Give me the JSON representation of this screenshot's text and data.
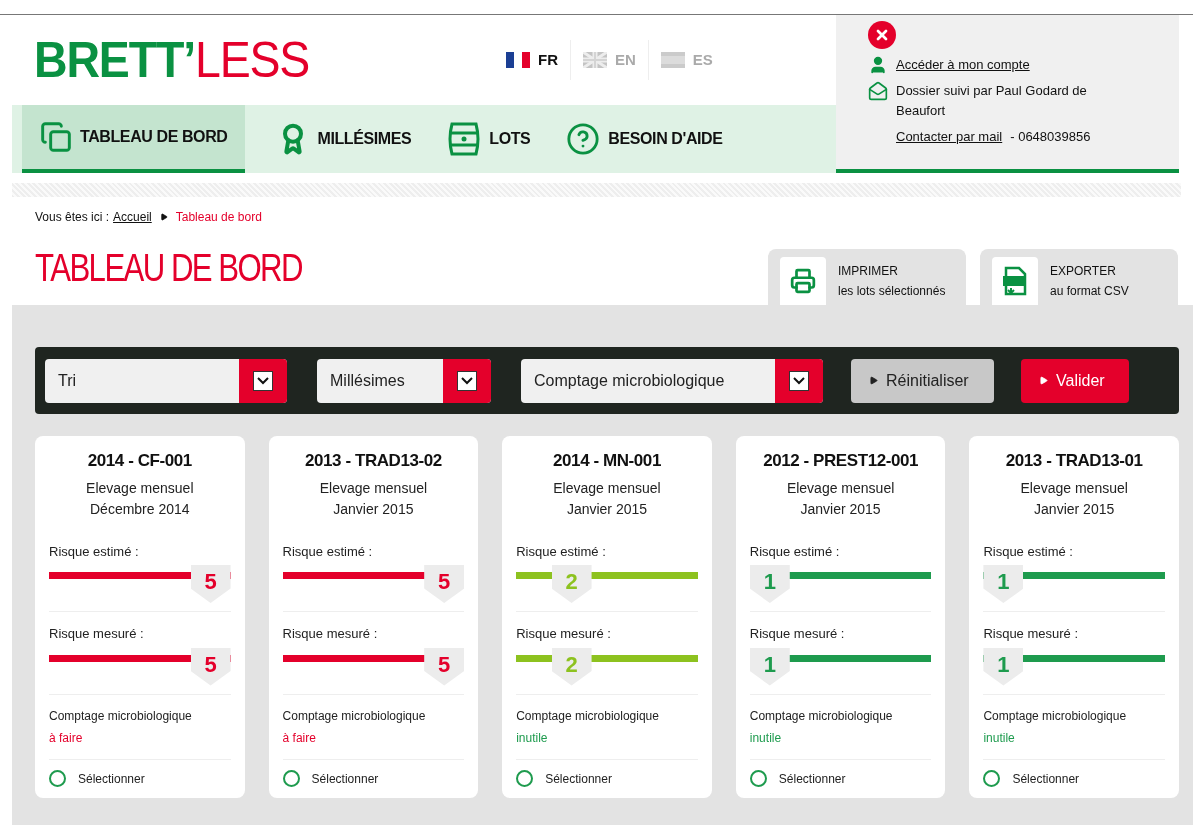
{
  "logo": {
    "first": "BRETT’",
    "second": "LESS"
  },
  "languages": [
    {
      "code": "FR",
      "selected": true
    },
    {
      "code": "EN",
      "selected": false
    },
    {
      "code": "ES",
      "selected": false
    }
  ],
  "nav": [
    {
      "label": "TABLEAU DE BORD",
      "selected": true
    },
    {
      "label": "MILLÉSIMES",
      "selected": false
    },
    {
      "label": "LOTS",
      "selected": false
    },
    {
      "label": "BESOIN D'AIDE",
      "selected": false
    }
  ],
  "account": {
    "account_link": "Accéder à mon compte",
    "followed_by": "Dossier suivi par Paul Godard de Beaufort",
    "contact_link": "Contacter par mail",
    "phone": "- 0648039856"
  },
  "breadcrumb": {
    "prefix": "Vous êtes ici :",
    "home": "Accueil",
    "current": "Tableau de bord"
  },
  "page_title": "TABLEAU DE BORD",
  "actions": [
    {
      "title": "IMPRIMER",
      "subtitle": "les lots sélectionnés"
    },
    {
      "title": "EXPORTER",
      "subtitle": "au format CSV"
    }
  ],
  "filters": [
    {
      "value": "Tri"
    },
    {
      "value": "Millésimes"
    },
    {
      "value": "Comptage microbiologique"
    }
  ],
  "filter_buttons": [
    {
      "label": "Réinitialiser",
      "kind": "secondary"
    },
    {
      "label": "Valider",
      "kind": "primary"
    }
  ],
  "lots": [
    {
      "title": "2014 - CF-001",
      "type": "Elevage mensuel",
      "date": "Décembre 2014",
      "estimated": {
        "label": "Risque estimé :",
        "reading": "5",
        "level": 1,
        "color": "#e4002b"
      },
      "measured": {
        "label": "Risque mesuré :",
        "reading": "5",
        "level": 1,
        "color": "#e4002b"
      },
      "count": {
        "label": "Comptage microbiologique",
        "status": "à faire",
        "color": "#e4002b"
      },
      "select_label": "Sélectionner",
      "selected": false
    },
    {
      "title": "2013 - TRAD13-02",
      "type": "Elevage mensuel",
      "date": "Janvier 2015",
      "estimated": {
        "label": "Risque estimé :",
        "reading": "5",
        "level": 1,
        "color": "#e4002b"
      },
      "measured": {
        "label": "Risque mesuré :",
        "reading": "5",
        "level": 1,
        "color": "#e4002b"
      },
      "count": {
        "label": "Comptage microbiologique",
        "status": "à faire",
        "color": "#e4002b"
      },
      "select_label": "Sélectionner",
      "selected": false
    },
    {
      "title": "2014 - MN-001",
      "type": "Elevage mensuel",
      "date": "Janvier 2015",
      "estimated": {
        "label": "Risque estimé :",
        "reading": "2",
        "level": 0.25,
        "color": "#8dc21f"
      },
      "measured": {
        "label": "Risque mesuré :",
        "reading": "2",
        "level": 0.25,
        "color": "#8dc21f"
      },
      "count": {
        "label": "Comptage microbiologique",
        "status": "inutile",
        "color": "#1e9b4e"
      },
      "select_label": "Sélectionner",
      "selected": false
    },
    {
      "title": "2012 - PREST12-001",
      "type": "Elevage mensuel",
      "date": "Janvier 2015",
      "estimated": {
        "label": "Risque estimé :",
        "reading": "1",
        "level": 0,
        "color": "#1e9b4e"
      },
      "measured": {
        "label": "Risque mesuré :",
        "reading": "1",
        "level": 0,
        "color": "#1e9b4e"
      },
      "count": {
        "label": "Comptage microbiologique",
        "status": "inutile",
        "color": "#1e9b4e"
      },
      "select_label": "Sélectionner",
      "selected": false
    },
    {
      "title": "2013 - TRAD13-01",
      "type": "Elevage mensuel",
      "date": "Janvier 2015",
      "estimated": {
        "label": "Risque estimé :",
        "reading": "1",
        "level": 0,
        "color": "#1e9b4e"
      },
      "measured": {
        "label": "Risque mesuré :",
        "reading": "1",
        "level": 0,
        "color": "#1e9b4e"
      },
      "count": {
        "label": "Comptage microbiologique",
        "status": "inutile",
        "color": "#1e9b4e"
      },
      "select_label": "Sélectionner",
      "selected": false
    }
  ]
}
